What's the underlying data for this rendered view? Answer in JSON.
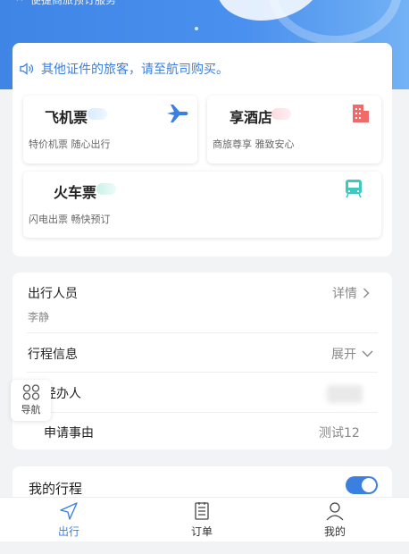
{
  "hero": {
    "text": "便捷商旅预订服务"
  },
  "notice": {
    "text": "其他证件的旅客，请至航司购买。",
    "icon": "speaker-icon"
  },
  "services": [
    {
      "title": "飞机票",
      "subtitle": "特价机票 随心出行",
      "icon": "airplane-icon",
      "color": "#3b7fe0"
    },
    {
      "title": "享酒店",
      "subtitle": "商旅尊享 雅致安心",
      "icon": "hotel-icon",
      "color": "#f06a6a"
    },
    {
      "title": "火车票",
      "subtitle": "闪电出票 畅快预订",
      "icon": "train-icon",
      "color": "#3fc8bf"
    }
  ],
  "info": {
    "traveler_label": "出行人员",
    "traveler_name": "李静",
    "traveler_action": "详情",
    "itinerary_label": "行程信息",
    "itinerary_action": "展开",
    "handler_label": "经办人",
    "reason_label": "申请事由",
    "reason_value": "测试12"
  },
  "nav_float": {
    "label": "导航"
  },
  "my_trips": {
    "label": "我的行程",
    "toggle_on": true
  },
  "tabs": [
    {
      "label": "出行",
      "icon": "navigation-arrow-icon",
      "active": true
    },
    {
      "label": "订单",
      "icon": "document-icon",
      "active": false
    },
    {
      "label": "我的",
      "icon": "user-icon",
      "active": false
    }
  ]
}
